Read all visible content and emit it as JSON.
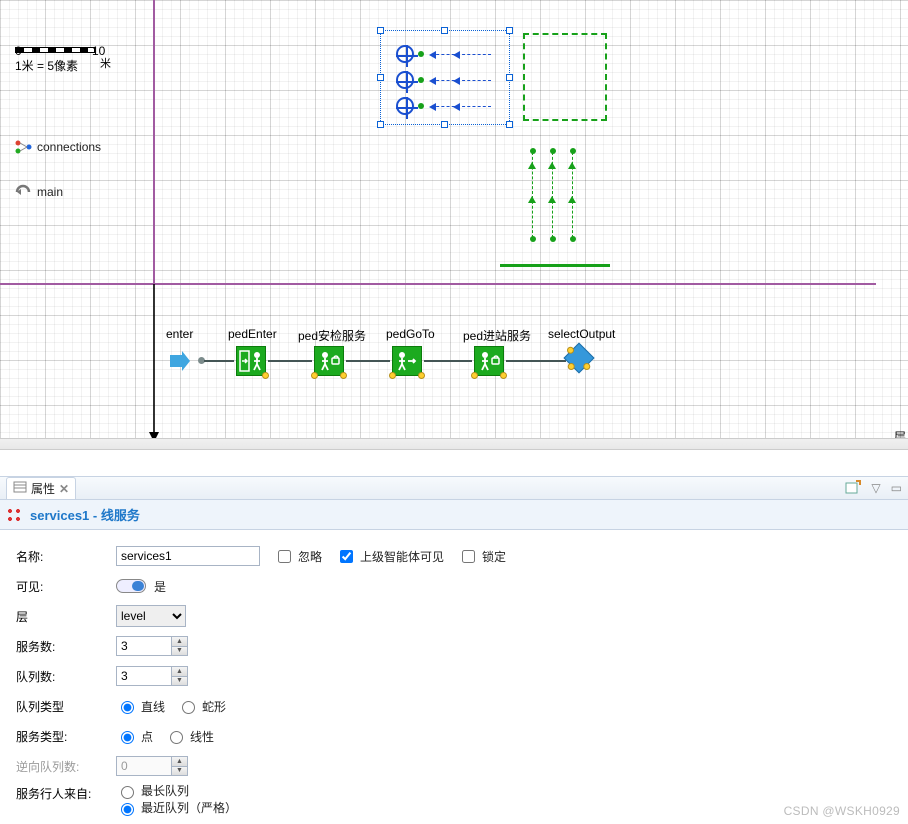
{
  "scale": {
    "n0": "0",
    "n10": "10",
    "unit": "米",
    "eq": "1米 = 5像素"
  },
  "tree": {
    "connections": "connections",
    "main": "main"
  },
  "services1": {
    "rows": 3,
    "queue_cols": 3
  },
  "flow": {
    "enter": "enter",
    "pedEnter": "pedEnter",
    "pedSecurity": "ped安检服务",
    "pedGoTo": "pedGoTo",
    "pedStation": "ped进站服务",
    "selectOutput": "selectOutput"
  },
  "right_label": "层",
  "tab": {
    "title": "属性"
  },
  "header": {
    "title": "services1 - 线服务"
  },
  "form": {
    "name_label": "名称:",
    "name_value": "services1",
    "ignore": "忽略",
    "parentVisible": "上级智能体可见",
    "lock": "锁定",
    "visible_label": "可见:",
    "visible_value": "是",
    "layer_label": "层",
    "layer_value": "level",
    "svc_count_label": "服务数:",
    "svc_count_value": "3",
    "queue_count_label": "队列数:",
    "queue_count_value": "3",
    "queue_type_label": "队列类型",
    "queue_type_opt1": "直线",
    "queue_type_opt2": "蛇形",
    "svc_type_label": "服务类型:",
    "svc_type_opt1": "点",
    "svc_type_opt2": "线性",
    "reverse_label": "逆向队列数:",
    "reverse_value": "0",
    "from_label": "服务行人来自:",
    "from_opt1": "最长队列",
    "from_opt2": "最近队列（严格）"
  },
  "watermark": "CSDN @WSKH0929"
}
